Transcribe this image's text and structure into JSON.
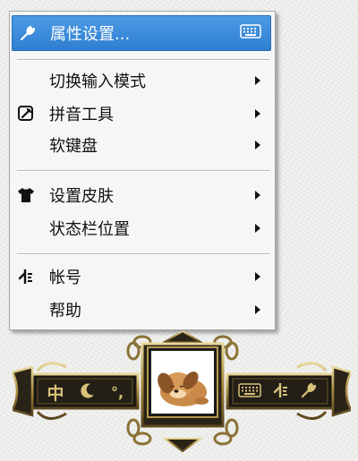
{
  "context_menu": {
    "items": [
      {
        "label": "属性设置...",
        "icon": "wrench-icon",
        "shortcut_icon": "keyboard-icon",
        "highlighted": true,
        "submenu": false
      },
      {
        "label": "切换输入模式",
        "icon": null,
        "submenu": true
      },
      {
        "label": "拼音工具",
        "icon": "pinyin-tool-icon",
        "submenu": true
      },
      {
        "label": "软键盘",
        "icon": null,
        "submenu": true
      },
      {
        "label": "设置皮肤",
        "icon": "tshirt-icon",
        "submenu": true
      },
      {
        "label": "状态栏位置",
        "icon": null,
        "submenu": true
      },
      {
        "label": "帐号",
        "icon": "account-icon",
        "submenu": true
      },
      {
        "label": "帮助",
        "icon": null,
        "submenu": true
      }
    ]
  },
  "status_bar": {
    "mode_label": "中",
    "punctuation_label": "°,",
    "skin": "puppy",
    "accent_color": "#d8c279"
  },
  "colors": {
    "highlight": "#3a8ade",
    "menu_bg": "#f6f6f6",
    "text": "#111111"
  }
}
